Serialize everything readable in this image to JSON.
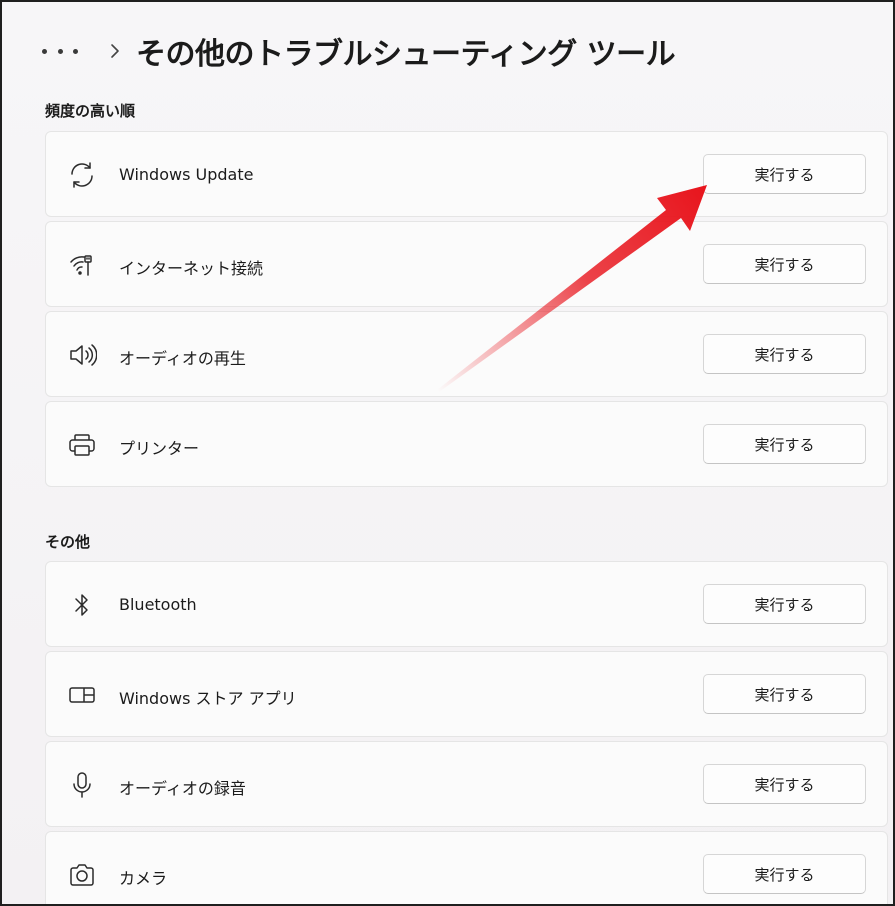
{
  "header": {
    "title": "その他のトラブルシューティング ツール",
    "more_icon": "more-dots-icon",
    "separator_icon": "chevron-right-icon"
  },
  "sections": [
    {
      "label": "頻度の高い順",
      "items": [
        {
          "label": "Windows Update",
          "icon": "refresh-icon",
          "button": "実行する"
        },
        {
          "label": "インターネット接続",
          "icon": "wifi-ethernet-icon",
          "button": "実行する"
        },
        {
          "label": "オーディオの再生",
          "icon": "speaker-icon",
          "button": "実行する"
        },
        {
          "label": "プリンター",
          "icon": "printer-icon",
          "button": "実行する"
        }
      ]
    },
    {
      "label": "その他",
      "items": [
        {
          "label": "Bluetooth",
          "icon": "bluetooth-icon",
          "button": "実行する"
        },
        {
          "label": "Windows ストア アプリ",
          "icon": "store-app-icon",
          "button": "実行する"
        },
        {
          "label": "オーディオの録音",
          "icon": "microphone-icon",
          "button": "実行する"
        },
        {
          "label": "カメラ",
          "icon": "camera-icon",
          "button": "実行する"
        }
      ]
    }
  ],
  "colors": {
    "arrow": "#e8141c",
    "card_bg": "#fbfbfb",
    "page_bg": "#f4f2f4"
  }
}
